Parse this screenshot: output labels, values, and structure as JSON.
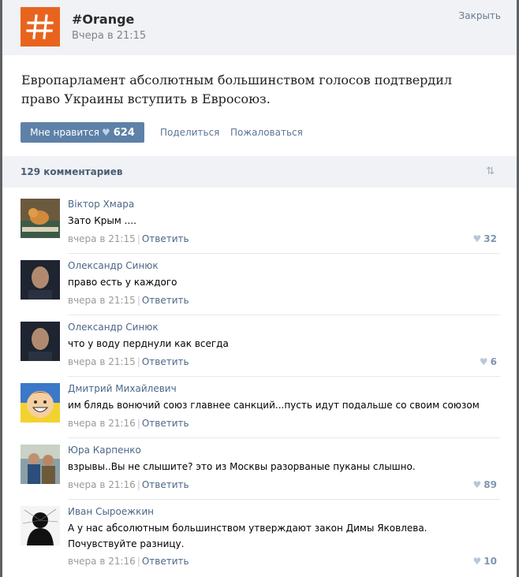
{
  "header": {
    "group_name": "#Orange",
    "time": "Вчера в 21:15",
    "close_label": "Закрыть",
    "avatar_symbol": "#",
    "avatar_color": "#e8641e"
  },
  "post": {
    "text": "Европарламент абсолютным большинством голосов подтвердил право Украины вступить в Евросоюз.",
    "like_label": "Мне нравится",
    "like_count": "624",
    "share_label": "Поделиться",
    "report_label": "Пожаловаться"
  },
  "comments_bar": {
    "count_label": "129 комментариев",
    "sort_icon": "sort-arrows-icon"
  },
  "comments": [
    {
      "author": "Віктор Хмара",
      "text": "Зато Крым ....",
      "time": "вчера в 21:15",
      "reply": "Ответить",
      "likes": "32"
    },
    {
      "author": "Олександр Синюк",
      "text": "право есть у каждого",
      "time": "вчера в 21:15",
      "reply": "Ответить",
      "likes": ""
    },
    {
      "author": "Олександр Синюк",
      "text": "что у воду перднули как всегда",
      "time": "вчера в 21:15",
      "reply": "Ответить",
      "likes": "6"
    },
    {
      "author": "Дмитрий Михайлевич",
      "text": "им блядь вонючий союз главнее санкций...пусть идут подальше со своим союзом",
      "time": "вчера в 21:16",
      "reply": "Ответить",
      "likes": ""
    },
    {
      "author": "Юра Карпенко",
      "text": "взрывы..Вы не слышите? это из Москвы разорваные пуканы слышно.",
      "time": "вчера в 21:16",
      "reply": "Ответить",
      "likes": "89"
    },
    {
      "author": "Иван Сыроежкин",
      "text": "А у нас абсолютным большинством утверждают закон Димы Яковлева.",
      "text2": "Почувствуйте разницу.",
      "time": "вчера в 21:16",
      "reply": "Ответить",
      "likes": "10"
    }
  ]
}
